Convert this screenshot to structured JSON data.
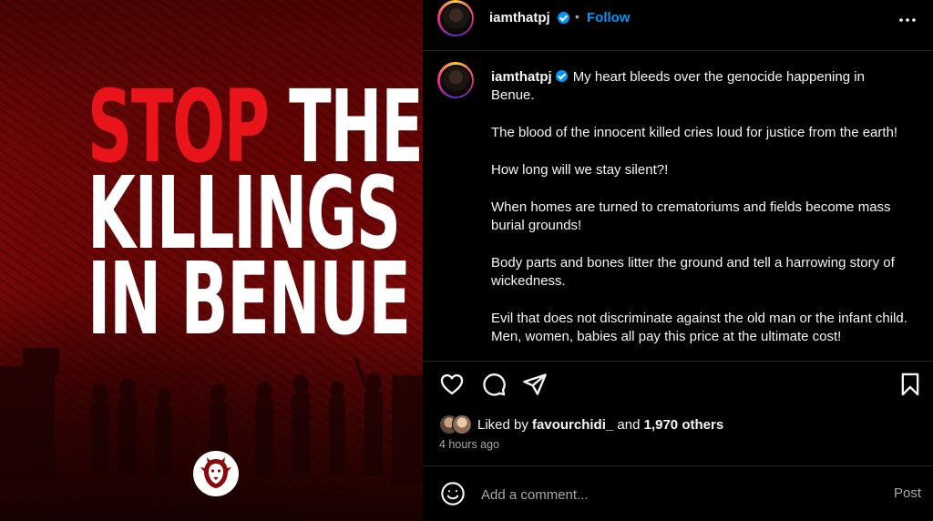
{
  "image": {
    "headline_words": [
      "STOP",
      "THE",
      "KILLINGS",
      "IN BENUE"
    ],
    "logo_icon": "lion-head-icon",
    "colors": {
      "red": "#e8141a",
      "white": "#ffffff",
      "background": "#7a0808"
    }
  },
  "header": {
    "username": "iamthatpj",
    "verified_icon": "verified-badge-icon",
    "separator": "•",
    "follow_label": "Follow",
    "more_icon": "more-options-icon"
  },
  "caption": {
    "username": "iamthatpj",
    "paragraphs": [
      "My heart bleeds over the genocide happening in Benue.",
      "The blood of the innocent killed cries loud for justice from the earth!",
      "How long will we stay silent?!",
      "When homes are turned to crematoriums and fields become mass burial grounds!",
      "Body parts and bones litter the ground and tell a harrowing story of wickedness.",
      "Evil that does not discriminate against the old man or the infant child. Men, women, babies all pay this price at the ultimate cost!"
    ]
  },
  "actions": {
    "like_icon": "heart-icon",
    "comment_icon": "comment-icon",
    "share_icon": "share-icon",
    "save_icon": "bookmark-icon"
  },
  "likes": {
    "prefix": "Liked by ",
    "user": "favourchidi_",
    "middle": " and ",
    "others": "1,970 others"
  },
  "timestamp": "4 hours ago",
  "comment": {
    "emoji_icon": "emoji-icon",
    "placeholder": "Add a comment...",
    "post_label": "Post"
  },
  "colors": {
    "accent": "#0095f6",
    "background": "#000000",
    "muted_text": "#a8a8a8",
    "divider": "#262626"
  }
}
